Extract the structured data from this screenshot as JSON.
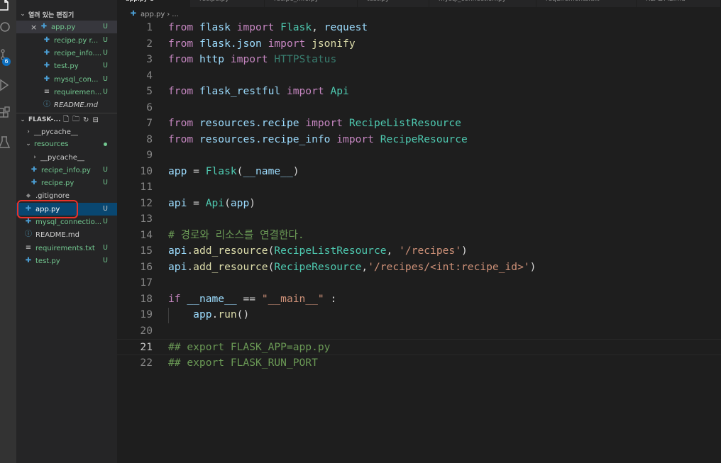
{
  "activity_bar": {
    "icons": [
      "explorer-icon",
      "search-icon",
      "source-control-icon",
      "run-debug-icon",
      "extensions-icon",
      "testing-icon"
    ],
    "source_control_badge": "6"
  },
  "sidebar": {
    "open_editors_title": "열려 있는 편집기",
    "open_editors": [
      {
        "name": "app.py",
        "status": "U",
        "icon": "python-icon",
        "close": "×"
      },
      {
        "name": "recipe.py r...",
        "status": "U",
        "icon": "python-icon"
      },
      {
        "name": "recipe_info....",
        "status": "U",
        "icon": "python-icon"
      },
      {
        "name": "test.py",
        "status": "U",
        "icon": "python-icon"
      },
      {
        "name": "mysql_con...",
        "status": "U",
        "icon": "python-icon"
      },
      {
        "name": "requiremen...",
        "status": "U",
        "icon": "text-file-icon"
      },
      {
        "name": "README.md",
        "status": "",
        "icon": "info-icon"
      }
    ],
    "folder_title": "FLASK-...",
    "tree": [
      {
        "name": "__pycache__",
        "type": "folder",
        "expanded": false,
        "status": ""
      },
      {
        "name": "resources",
        "type": "folder",
        "expanded": true,
        "status": "dot"
      },
      {
        "name": "__pycache__",
        "type": "folder",
        "expanded": false,
        "status": ""
      },
      {
        "name": "recipe_info.py",
        "type": "python",
        "status": "U"
      },
      {
        "name": "recipe.py",
        "type": "python",
        "status": "U"
      },
      {
        "name": ".gitignore",
        "type": "git",
        "status": ""
      },
      {
        "name": "app.py",
        "type": "python",
        "status": "U",
        "selected": true
      },
      {
        "name": "mysql_connectio...",
        "type": "python",
        "status": "U"
      },
      {
        "name": "README.md",
        "type": "info",
        "status": ""
      },
      {
        "name": "requirements.txt",
        "type": "text",
        "status": "U"
      },
      {
        "name": "test.py",
        "type": "python",
        "status": "U"
      }
    ]
  },
  "tabs": [
    {
      "label": "app.py   U",
      "active": true
    },
    {
      "label": "recipe.py"
    },
    {
      "label": "recipe_info.py"
    },
    {
      "label": "test.py"
    },
    {
      "label": "mysql_connection.py"
    },
    {
      "label": "requirements.txt"
    },
    {
      "label": "README.md"
    }
  ],
  "breadcrumb": {
    "file": "app.py",
    "separator": "›",
    "rest": "..."
  },
  "editor": {
    "current_line": 21,
    "lines": [
      {
        "n": "1"
      },
      {
        "n": "2"
      },
      {
        "n": "3"
      },
      {
        "n": "4"
      },
      {
        "n": "5"
      },
      {
        "n": "6"
      },
      {
        "n": "7"
      },
      {
        "n": "8"
      },
      {
        "n": "9"
      },
      {
        "n": "10"
      },
      {
        "n": "11"
      },
      {
        "n": "12"
      },
      {
        "n": "13"
      },
      {
        "n": "14"
      },
      {
        "n": "15"
      },
      {
        "n": "16"
      },
      {
        "n": "17"
      },
      {
        "n": "18"
      },
      {
        "n": "19"
      },
      {
        "n": "20"
      },
      {
        "n": "21"
      },
      {
        "n": "22"
      }
    ],
    "code": {
      "l1": [
        "from",
        " flask ",
        "import",
        " Flask",
        ", ",
        "request"
      ],
      "l2": [
        "from",
        " flask.json ",
        "import",
        " jsonify"
      ],
      "l3": [
        "from",
        " http ",
        "import",
        " HTTPStatus"
      ],
      "l5": [
        "from",
        " flask_restful ",
        "import",
        " Api"
      ],
      "l7": [
        "from",
        " resources.recipe ",
        "import",
        " RecipeListResource"
      ],
      "l8": [
        "from",
        " resources.recipe_info ",
        "import",
        " RecipeResource"
      ],
      "l10": [
        "app",
        " = ",
        "Flask",
        "(",
        "__name__",
        ")"
      ],
      "l12": [
        "api",
        " = ",
        "Api",
        "(",
        "app",
        ")"
      ],
      "l14": "# 경로와 리소스를 연결한다.",
      "l15": [
        "api",
        ".",
        "add_resource",
        "(",
        "RecipeListResource",
        ", ",
        "'/recipes'",
        ")"
      ],
      "l16": [
        "api",
        ".",
        "add_resource",
        "(",
        "RecipeResource",
        ",",
        "'/recipes/<int:recipe_id>'",
        ")"
      ],
      "l18": [
        "if",
        " ",
        "__name__",
        " == ",
        "\"__main__\"",
        " :"
      ],
      "l19": [
        "    ",
        "app",
        ".",
        "run",
        "()"
      ],
      "l21": "## export FLASK_APP=app.py",
      "l22": "## export FLASK_RUN_PORT"
    }
  }
}
